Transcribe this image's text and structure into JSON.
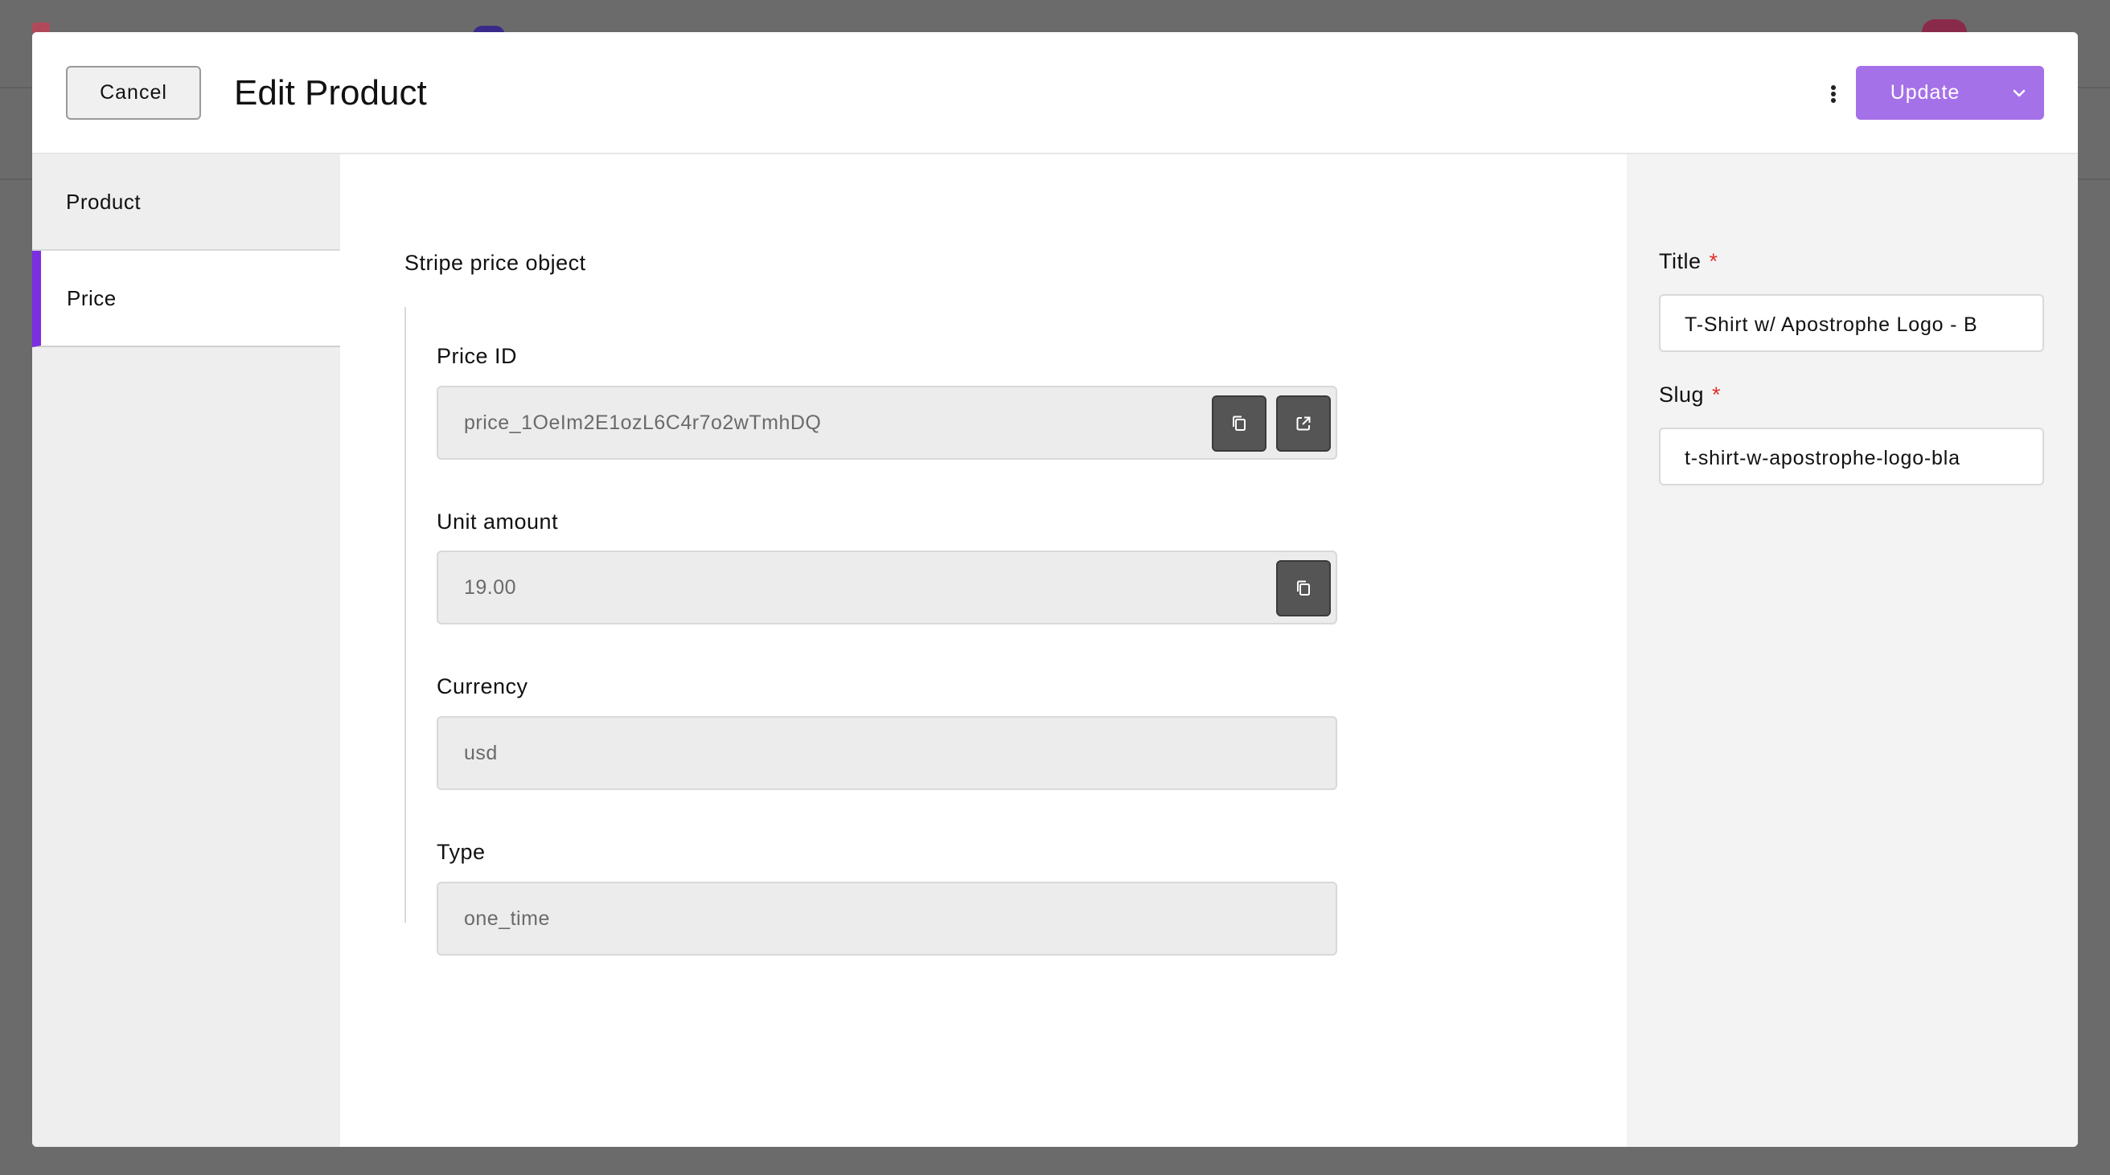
{
  "modal": {
    "cancel_label": "Cancel",
    "title": "Edit Product",
    "more_icon": "more-vertical-icon",
    "update_label": "Update",
    "update_toggle_icon": "chevron-down-icon"
  },
  "sidebar": {
    "tabs": [
      {
        "label": "Product",
        "active": false
      },
      {
        "label": "Price",
        "active": true
      }
    ],
    "accent_color": "#7a2fe0"
  },
  "main": {
    "section_title": "Stripe price object",
    "fields": [
      {
        "label": "Price ID",
        "value": "price_1OeIm2E1ozL6C4r7o2wTmhDQ",
        "actions": [
          "copy-icon",
          "external-link-icon"
        ]
      },
      {
        "label": "Unit amount",
        "value": "19.00",
        "actions": [
          "copy-icon"
        ]
      },
      {
        "label": "Currency",
        "value": "usd",
        "actions": []
      },
      {
        "label": "Type",
        "value": "one_time",
        "actions": []
      }
    ]
  },
  "right_panel": {
    "title_label": "Title",
    "title_required": "*",
    "title_value": "T-Shirt w/ Apostrophe Logo - B",
    "slug_label": "Slug",
    "slug_required": "*",
    "slug_value": "t-shirt-w-apostrophe-logo-bla"
  },
  "colors": {
    "primary": "#a571e8",
    "required": "#e0312c"
  }
}
